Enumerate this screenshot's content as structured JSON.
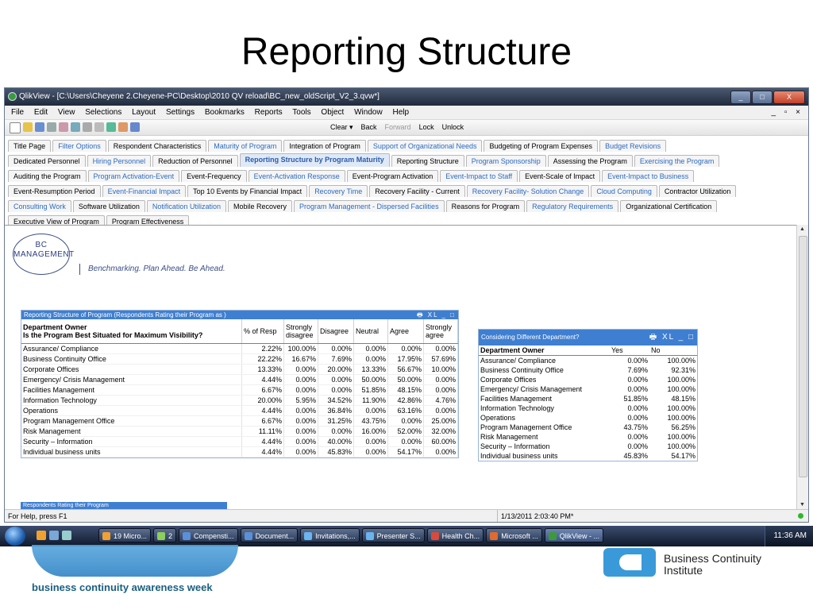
{
  "slide": {
    "title": "Reporting Structure"
  },
  "window": {
    "title": "QlikView - [C:\\Users\\Cheyene 2.Cheyene-PC\\Desktop\\2010 QV reload\\BC_new_oldScript_V2_3.qvw*]",
    "controls": [
      "_",
      "□",
      "X"
    ]
  },
  "menu": {
    "items": [
      "File",
      "Edit",
      "View",
      "Selections",
      "Layout",
      "Settings",
      "Bookmarks",
      "Reports",
      "Tools",
      "Object",
      "Window",
      "Help"
    ],
    "mdi": "_ ▫ ×"
  },
  "toolbar": {
    "clear": "Clear ▾",
    "back": "Back",
    "forward": "Forward",
    "lock": "Lock",
    "unlock": "Unlock"
  },
  "tabs": [
    [
      {
        "label": "Title Page",
        "blue": false
      },
      {
        "label": "Filter Options",
        "blue": true
      },
      {
        "label": "Respondent Characteristics",
        "blue": false
      },
      {
        "label": "Maturity of Program",
        "blue": true
      },
      {
        "label": "Integration of Program",
        "blue": false
      },
      {
        "label": "Support of Organizational Needs",
        "blue": true
      },
      {
        "label": "Budgeting of Program Expenses",
        "blue": false
      },
      {
        "label": "Budget Revisions",
        "blue": true
      }
    ],
    [
      {
        "label": "Dedicated Personnel",
        "blue": false
      },
      {
        "label": "Hiring Personnel",
        "blue": true
      },
      {
        "label": "Reduction of Personnel",
        "blue": false
      },
      {
        "label": "Reporting Structure by Program Maturity",
        "blue": true,
        "active": true
      },
      {
        "label": "Reporting Structure",
        "blue": false
      },
      {
        "label": "Program Sponsorship",
        "blue": true
      },
      {
        "label": "Assessing the Program",
        "blue": false
      },
      {
        "label": "Exercising the Program",
        "blue": true
      }
    ],
    [
      {
        "label": "Auditing the Program",
        "blue": false
      },
      {
        "label": "Program Activation-Event",
        "blue": true
      },
      {
        "label": "Event-Frequency",
        "blue": false
      },
      {
        "label": "Event-Activation Response",
        "blue": true
      },
      {
        "label": "Event-Program Activation",
        "blue": false
      },
      {
        "label": "Event-Impact to Staff",
        "blue": true
      },
      {
        "label": "Event-Scale of Impact",
        "blue": false
      },
      {
        "label": "Event-Impact to Business",
        "blue": true
      }
    ],
    [
      {
        "label": "Event-Resumption Period",
        "blue": false
      },
      {
        "label": "Event-Financial Impact",
        "blue": true
      },
      {
        "label": "Top 10 Events by Financial Impact",
        "blue": false
      },
      {
        "label": "Recovery Time",
        "blue": true
      },
      {
        "label": "Recovery Facility - Current",
        "blue": false
      },
      {
        "label": "Recovery Facility- Solution Change",
        "blue": true
      },
      {
        "label": "Cloud Computing",
        "blue": true
      },
      {
        "label": "Contractor Utilization",
        "blue": false
      }
    ],
    [
      {
        "label": "Consulting Work",
        "blue": true
      },
      {
        "label": "Software Utilization",
        "blue": false
      },
      {
        "label": "Notification Utilization",
        "blue": true
      },
      {
        "label": "Mobile Recovery",
        "blue": false
      },
      {
        "label": "Program Management - Dispersed Facilities",
        "blue": true
      },
      {
        "label": "Reasons for Program",
        "blue": false
      },
      {
        "label": "Regulatory Requirements",
        "blue": true
      },
      {
        "label": "Organizational Certification",
        "blue": false
      }
    ],
    [
      {
        "label": "Executive View of Program",
        "blue": false
      },
      {
        "label": "Program Effectiveness",
        "blue": false
      }
    ]
  ],
  "logo": {
    "line1": "BC",
    "line2": "MANAGEMENT",
    "tagline": "Benchmarking.  Plan Ahead.  Be Ahead."
  },
  "table1": {
    "caption": "Reporting Structure of Program (Respondents Rating their Program as )",
    "header_dim1": "Department Owner",
    "header_dim2": "Is the Program Best Situated for Maximum Visibility?",
    "columns": [
      "% of Resp",
      "Strongly disagree",
      "Disagree",
      "Neutral",
      "Agree",
      "Strongly agree"
    ],
    "rows": [
      {
        "label": "Assurance/ Compliance",
        "values": [
          "2.22%",
          "100.00%",
          "0.00%",
          "0.00%",
          "0.00%",
          "0.00%"
        ]
      },
      {
        "label": "Business Continuity Office",
        "values": [
          "22.22%",
          "16.67%",
          "7.69%",
          "0.00%",
          "17.95%",
          "57.69%"
        ]
      },
      {
        "label": "Corporate Offices",
        "values": [
          "13.33%",
          "0.00%",
          "20.00%",
          "13.33%",
          "56.67%",
          "10.00%"
        ]
      },
      {
        "label": "Emergency/ Crisis Management",
        "values": [
          "4.44%",
          "0.00%",
          "0.00%",
          "50.00%",
          "50.00%",
          "0.00%"
        ]
      },
      {
        "label": "Facilities Management",
        "values": [
          "6.67%",
          "0.00%",
          "0.00%",
          "51.85%",
          "48.15%",
          "0.00%"
        ]
      },
      {
        "label": "Information Technology",
        "values": [
          "20.00%",
          "5.95%",
          "34.52%",
          "11.90%",
          "42.86%",
          "4.76%"
        ]
      },
      {
        "label": "Operations",
        "values": [
          "4.44%",
          "0.00%",
          "36.84%",
          "0.00%",
          "63.16%",
          "0.00%"
        ]
      },
      {
        "label": "Program Management Office",
        "values": [
          "6.67%",
          "0.00%",
          "31.25%",
          "43.75%",
          "0.00%",
          "25.00%"
        ]
      },
      {
        "label": "Risk Management",
        "values": [
          "11.11%",
          "0.00%",
          "0.00%",
          "16.00%",
          "52.00%",
          "32.00%"
        ]
      },
      {
        "label": " Security – Information",
        "values": [
          "4.44%",
          "0.00%",
          "40.00%",
          "0.00%",
          "0.00%",
          "60.00%"
        ]
      },
      {
        "label": "Individual business units",
        "values": [
          "4.44%",
          "0.00%",
          "45.83%",
          "0.00%",
          "54.17%",
          "0.00%"
        ]
      }
    ]
  },
  "table2": {
    "caption": "Considering Different Department?",
    "columns": [
      "Department Owner",
      "Yes",
      "No"
    ],
    "rows": [
      {
        "label": "Assurance/ Compliance",
        "values": [
          "0.00%",
          "100.00%"
        ]
      },
      {
        "label": "Business Continuity Office",
        "values": [
          "7.69%",
          "92.31%"
        ]
      },
      {
        "label": "Corporate Offices",
        "values": [
          "0.00%",
          "100.00%"
        ]
      },
      {
        "label": "Emergency/ Crisis Management",
        "values": [
          "0.00%",
          "100.00%"
        ]
      },
      {
        "label": "Facilities Management",
        "values": [
          "51.85%",
          "48.15%"
        ]
      },
      {
        "label": "Information Technology",
        "values": [
          "0.00%",
          "100.00%"
        ]
      },
      {
        "label": "Operations",
        "values": [
          "0.00%",
          "100.00%"
        ]
      },
      {
        "label": "Program Management Office",
        "values": [
          "43.75%",
          "56.25%"
        ]
      },
      {
        "label": "Risk Management",
        "values": [
          "0.00%",
          "100.00%"
        ]
      },
      {
        "label": " Security – Information",
        "values": [
          "0.00%",
          "100.00%"
        ]
      },
      {
        "label": "Individual business units",
        "values": [
          "45.83%",
          "54.17%"
        ]
      }
    ]
  },
  "table3": {
    "caption": "Respondents Rating their Program"
  },
  "status": {
    "help": "For Help, press F1",
    "timestamp": "1/13/2011 2:03:40 PM*"
  },
  "taskbar": {
    "tasks": [
      {
        "label": "19 Micro...",
        "color": "#f4a030"
      },
      {
        "label": "2",
        "color": "#8ccf5a"
      },
      {
        "label": "Compensti...",
        "color": "#5b8fd8"
      },
      {
        "label": "Document...",
        "color": "#5b8fd8"
      },
      {
        "label": "Invitations,...",
        "color": "#6ab4f0"
      },
      {
        "label": "Presenter S...",
        "color": "#6ab4f0"
      },
      {
        "label": "Health Ch...",
        "color": "#d84a3a"
      },
      {
        "label": "Microsoft ...",
        "color": "#e06a30"
      },
      {
        "label": "QlikView - ...",
        "color": "#3c9a3c",
        "active": true
      }
    ],
    "clock": "11:36 AM"
  },
  "footer": {
    "bcaw_text": "business continuity awareness week",
    "bci_line1": "Business Continuity",
    "bci_line2": "Institute"
  }
}
